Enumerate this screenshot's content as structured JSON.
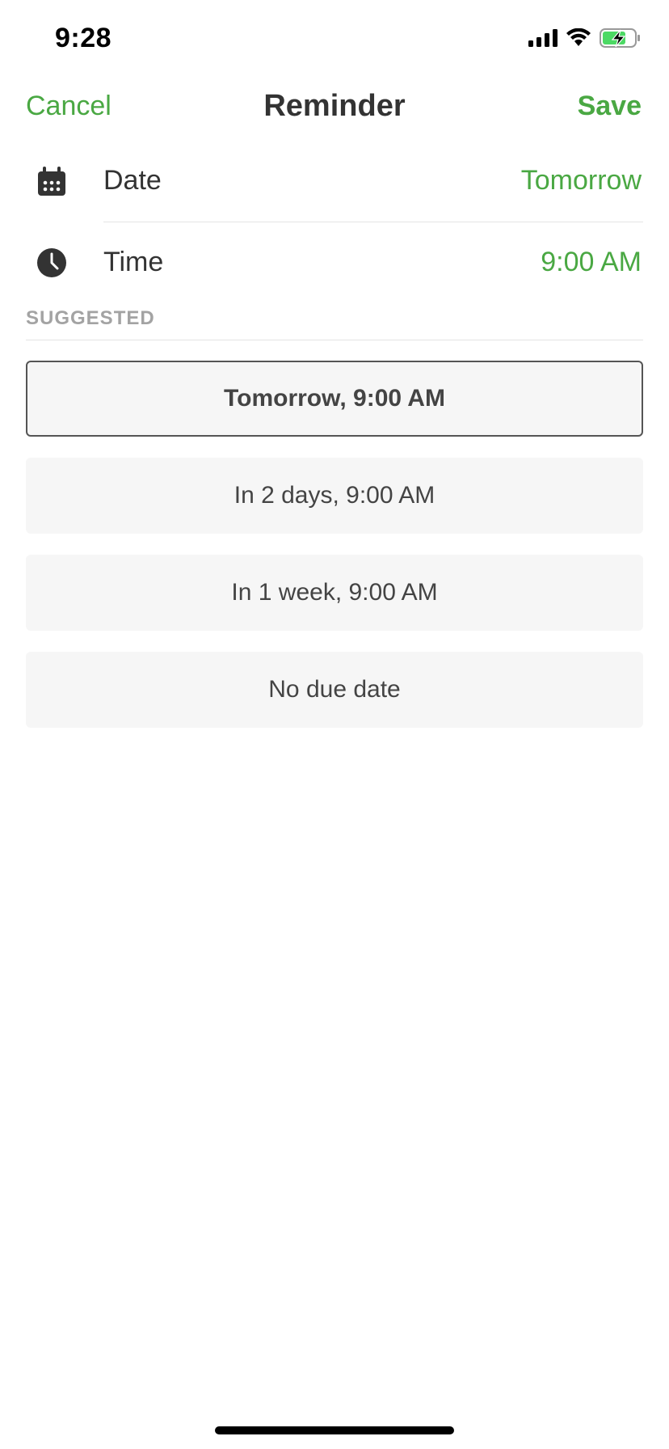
{
  "status_bar": {
    "time": "9:28",
    "icons": [
      "cellular-signal-icon",
      "wifi-icon",
      "battery-charging-icon"
    ]
  },
  "nav": {
    "cancel_label": "Cancel",
    "title": "Reminder",
    "save_label": "Save"
  },
  "fields": {
    "date": {
      "label": "Date",
      "value": "Tomorrow",
      "icon": "calendar-icon"
    },
    "time": {
      "label": "Time",
      "value": "9:00 AM",
      "icon": "clock-icon"
    }
  },
  "suggested": {
    "header": "SUGGESTED",
    "options": [
      {
        "label": "Tomorrow, 9:00 AM",
        "selected": true
      },
      {
        "label": "In 2 days, 9:00 AM",
        "selected": false
      },
      {
        "label": "In 1 week, 9:00 AM",
        "selected": false
      },
      {
        "label": "No due date",
        "selected": false
      }
    ]
  },
  "colors": {
    "accent": "#4aa843",
    "text": "#333333",
    "muted": "#a3a3a3",
    "option_bg": "#f6f6f6"
  }
}
